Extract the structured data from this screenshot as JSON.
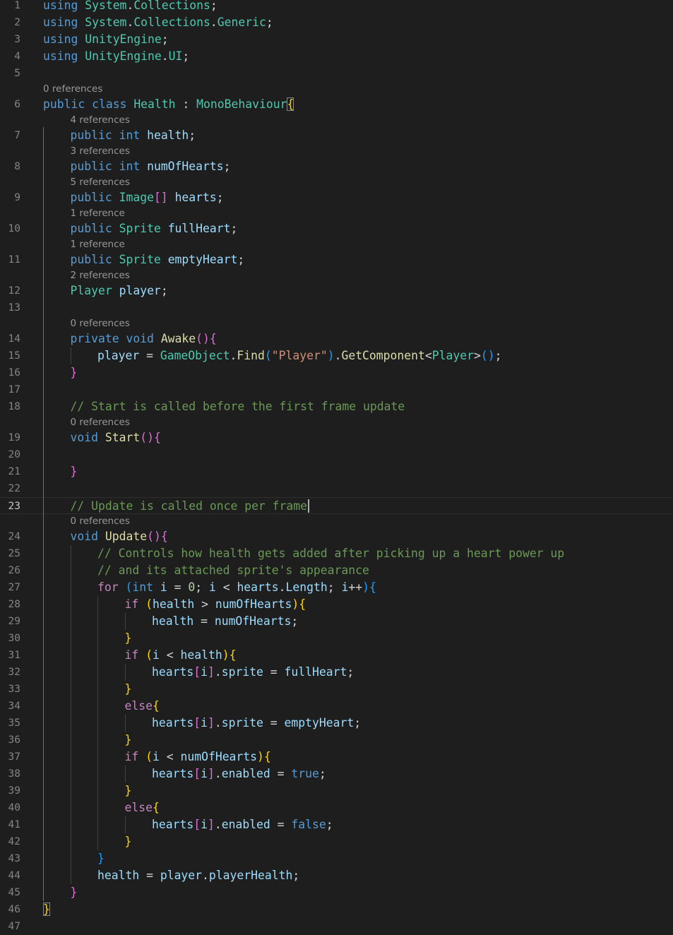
{
  "editor": {
    "active_line": 23,
    "cursor_line": 23,
    "tab_width": 4
  },
  "colors": {
    "background": "#1e1e1e",
    "line_number": "#858585",
    "line_number_active": "#c6c6c6",
    "keyword": "#569cd6",
    "control_keyword": "#c586c0",
    "type": "#4ec9b0",
    "function": "#dcdcaa",
    "variable": "#9cdcfe",
    "string": "#ce9178",
    "number": "#b5cea8",
    "comment": "#6a9955",
    "bracket_level_1": "#ffd700",
    "bracket_level_2": "#da70d6",
    "bracket_level_3": "#179fff",
    "codelens": "#999999"
  },
  "lines": [
    {
      "n": "1",
      "tokens": [
        [
          "k",
          "using"
        ],
        [
          "p",
          " "
        ],
        [
          "t",
          "System"
        ],
        [
          "p",
          "."
        ],
        [
          "t",
          "Collections"
        ],
        [
          "p",
          ";"
        ]
      ]
    },
    {
      "n": "2",
      "tokens": [
        [
          "k",
          "using"
        ],
        [
          "p",
          " "
        ],
        [
          "t",
          "System"
        ],
        [
          "p",
          "."
        ],
        [
          "t",
          "Collections"
        ],
        [
          "p",
          "."
        ],
        [
          "t",
          "Generic"
        ],
        [
          "p",
          ";"
        ]
      ]
    },
    {
      "n": "3",
      "tokens": [
        [
          "k",
          "using"
        ],
        [
          "p",
          " "
        ],
        [
          "t",
          "UnityEngine"
        ],
        [
          "p",
          ";"
        ]
      ]
    },
    {
      "n": "4",
      "tokens": [
        [
          "k",
          "using"
        ],
        [
          "p",
          " "
        ],
        [
          "t",
          "UnityEngine"
        ],
        [
          "p",
          "."
        ],
        [
          "t",
          "UI"
        ],
        [
          "p",
          ";"
        ]
      ]
    },
    {
      "n": "5",
      "tokens": []
    },
    {
      "n": "6",
      "lens": "0 references",
      "tokens": [
        [
          "k",
          "public"
        ],
        [
          "p",
          " "
        ],
        [
          "k",
          "class"
        ],
        [
          "p",
          " "
        ],
        [
          "t",
          "Health"
        ],
        [
          "p",
          " : "
        ],
        [
          "t",
          "MonoBehaviour"
        ],
        [
          "b1m",
          "{"
        ]
      ]
    },
    {
      "n": "7",
      "lens": "4 references",
      "indent": 1,
      "tokens": [
        [
          "k",
          "public"
        ],
        [
          "p",
          " "
        ],
        [
          "k",
          "int"
        ],
        [
          "p",
          " "
        ],
        [
          "v",
          "health"
        ],
        [
          "p",
          ";"
        ]
      ]
    },
    {
      "n": "8",
      "lens": "3 references",
      "indent": 1,
      "tokens": [
        [
          "k",
          "public"
        ],
        [
          "p",
          " "
        ],
        [
          "k",
          "int"
        ],
        [
          "p",
          " "
        ],
        [
          "v",
          "numOfHearts"
        ],
        [
          "p",
          ";"
        ]
      ]
    },
    {
      "n": "9",
      "lens": "5 references",
      "indent": 1,
      "tokens": [
        [
          "k",
          "public"
        ],
        [
          "p",
          " "
        ],
        [
          "t",
          "Image"
        ],
        [
          "b2",
          "[]"
        ],
        [
          "p",
          " "
        ],
        [
          "v",
          "hearts"
        ],
        [
          "p",
          ";"
        ]
      ]
    },
    {
      "n": "10",
      "lens": "1 reference",
      "indent": 1,
      "tokens": [
        [
          "k",
          "public"
        ],
        [
          "p",
          " "
        ],
        [
          "t",
          "Sprite"
        ],
        [
          "p",
          " "
        ],
        [
          "v",
          "fullHeart"
        ],
        [
          "p",
          ";"
        ]
      ]
    },
    {
      "n": "11",
      "lens": "1 reference",
      "indent": 1,
      "tokens": [
        [
          "k",
          "public"
        ],
        [
          "p",
          " "
        ],
        [
          "t",
          "Sprite"
        ],
        [
          "p",
          " "
        ],
        [
          "v",
          "emptyHeart"
        ],
        [
          "p",
          ";"
        ]
      ]
    },
    {
      "n": "12",
      "lens": "2 references",
      "indent": 1,
      "tokens": [
        [
          "t",
          "Player"
        ],
        [
          "p",
          " "
        ],
        [
          "v",
          "player"
        ],
        [
          "p",
          ";"
        ]
      ]
    },
    {
      "n": "13",
      "tokens": []
    },
    {
      "n": "14",
      "lens": "0 references",
      "indent": 1,
      "tokens": [
        [
          "k",
          "private"
        ],
        [
          "p",
          " "
        ],
        [
          "k",
          "void"
        ],
        [
          "p",
          " "
        ],
        [
          "f",
          "Awake"
        ],
        [
          "b2",
          "(){"
        ]
      ]
    },
    {
      "n": "15",
      "indent": 2,
      "tokens": [
        [
          "v",
          "player"
        ],
        [
          "p",
          " = "
        ],
        [
          "t",
          "GameObject"
        ],
        [
          "p",
          "."
        ],
        [
          "f",
          "Find"
        ],
        [
          "b3",
          "("
        ],
        [
          "s",
          "\"Player\""
        ],
        [
          "b3",
          ")"
        ],
        [
          "p",
          "."
        ],
        [
          "f",
          "GetComponent"
        ],
        [
          "p",
          "<"
        ],
        [
          "t",
          "Player"
        ],
        [
          "p",
          ">"
        ],
        [
          "b3",
          "()"
        ],
        [
          "p",
          ";"
        ]
      ]
    },
    {
      "n": "16",
      "indent": 1,
      "tokens": [
        [
          "b2",
          "}"
        ]
      ]
    },
    {
      "n": "17",
      "tokens": []
    },
    {
      "n": "18",
      "indent": 1,
      "tokens": [
        [
          "cm",
          "// Start is called before the first frame update"
        ]
      ]
    },
    {
      "n": "19",
      "lens": "0 references",
      "indent": 1,
      "tokens": [
        [
          "k",
          "void"
        ],
        [
          "p",
          " "
        ],
        [
          "f",
          "Start"
        ],
        [
          "b2",
          "(){"
        ]
      ]
    },
    {
      "n": "20",
      "tokens": []
    },
    {
      "n": "21",
      "indent": 1,
      "tokens": [
        [
          "b2",
          "}"
        ]
      ]
    },
    {
      "n": "22",
      "tokens": []
    },
    {
      "n": "23",
      "indent": 1,
      "tokens": [
        [
          "cm",
          "// Update is called once per frame"
        ]
      ]
    },
    {
      "n": "24",
      "lens": "0 references",
      "indent": 1,
      "tokens": [
        [
          "k",
          "void"
        ],
        [
          "p",
          " "
        ],
        [
          "f",
          "Update"
        ],
        [
          "b2",
          "(){"
        ]
      ]
    },
    {
      "n": "25",
      "indent": 2,
      "tokens": [
        [
          "cm",
          "// Controls how health gets added after picking up a heart power up"
        ]
      ]
    },
    {
      "n": "26",
      "indent": 2,
      "tokens": [
        [
          "cm",
          "// and its attached sprite's appearance"
        ]
      ]
    },
    {
      "n": "27",
      "indent": 2,
      "tokens": [
        [
          "c",
          "for"
        ],
        [
          "p",
          " "
        ],
        [
          "b3",
          "("
        ],
        [
          "k",
          "int"
        ],
        [
          "p",
          " "
        ],
        [
          "v",
          "i"
        ],
        [
          "p",
          " = "
        ],
        [
          "n",
          "0"
        ],
        [
          "p",
          "; "
        ],
        [
          "v",
          "i"
        ],
        [
          "p",
          " < "
        ],
        [
          "v",
          "hearts"
        ],
        [
          "p",
          "."
        ],
        [
          "v",
          "Length"
        ],
        [
          "p",
          "; "
        ],
        [
          "v",
          "i"
        ],
        [
          "p",
          "++"
        ],
        [
          "b3",
          "){"
        ]
      ]
    },
    {
      "n": "28",
      "indent": 3,
      "tokens": [
        [
          "c",
          "if"
        ],
        [
          "p",
          " "
        ],
        [
          "b1",
          "("
        ],
        [
          "v",
          "health"
        ],
        [
          "p",
          " > "
        ],
        [
          "v",
          "numOfHearts"
        ],
        [
          "b1",
          "){"
        ]
      ]
    },
    {
      "n": "29",
      "indent": 4,
      "tokens": [
        [
          "v",
          "health"
        ],
        [
          "p",
          " = "
        ],
        [
          "v",
          "numOfHearts"
        ],
        [
          "p",
          ";"
        ]
      ]
    },
    {
      "n": "30",
      "indent": 3,
      "tokens": [
        [
          "b1",
          "}"
        ]
      ]
    },
    {
      "n": "31",
      "indent": 3,
      "tokens": [
        [
          "c",
          "if"
        ],
        [
          "p",
          " "
        ],
        [
          "b1",
          "("
        ],
        [
          "v",
          "i"
        ],
        [
          "p",
          " < "
        ],
        [
          "v",
          "health"
        ],
        [
          "b1",
          "){"
        ]
      ]
    },
    {
      "n": "32",
      "indent": 4,
      "tokens": [
        [
          "v",
          "hearts"
        ],
        [
          "b2",
          "["
        ],
        [
          "v",
          "i"
        ],
        [
          "b2",
          "]"
        ],
        [
          "p",
          "."
        ],
        [
          "v",
          "sprite"
        ],
        [
          "p",
          " = "
        ],
        [
          "v",
          "fullHeart"
        ],
        [
          "p",
          ";"
        ]
      ]
    },
    {
      "n": "33",
      "indent": 3,
      "tokens": [
        [
          "b1",
          "}"
        ]
      ]
    },
    {
      "n": "34",
      "indent": 3,
      "tokens": [
        [
          "c",
          "else"
        ],
        [
          "b1",
          "{"
        ]
      ]
    },
    {
      "n": "35",
      "indent": 4,
      "tokens": [
        [
          "v",
          "hearts"
        ],
        [
          "b2",
          "["
        ],
        [
          "v",
          "i"
        ],
        [
          "b2",
          "]"
        ],
        [
          "p",
          "."
        ],
        [
          "v",
          "sprite"
        ],
        [
          "p",
          " = "
        ],
        [
          "v",
          "emptyHeart"
        ],
        [
          "p",
          ";"
        ]
      ]
    },
    {
      "n": "36",
      "indent": 3,
      "tokens": [
        [
          "b1",
          "}"
        ]
      ]
    },
    {
      "n": "37",
      "indent": 3,
      "tokens": [
        [
          "c",
          "if"
        ],
        [
          "p",
          " "
        ],
        [
          "b1",
          "("
        ],
        [
          "v",
          "i"
        ],
        [
          "p",
          " < "
        ],
        [
          "v",
          "numOfHearts"
        ],
        [
          "b1",
          "){"
        ]
      ]
    },
    {
      "n": "38",
      "indent": 4,
      "tokens": [
        [
          "v",
          "hearts"
        ],
        [
          "b2",
          "["
        ],
        [
          "v",
          "i"
        ],
        [
          "b2",
          "]"
        ],
        [
          "p",
          "."
        ],
        [
          "v",
          "enabled"
        ],
        [
          "p",
          " = "
        ],
        [
          "k",
          "true"
        ],
        [
          "p",
          ";"
        ]
      ]
    },
    {
      "n": "39",
      "indent": 3,
      "tokens": [
        [
          "b1",
          "}"
        ]
      ]
    },
    {
      "n": "40",
      "indent": 3,
      "tokens": [
        [
          "c",
          "else"
        ],
        [
          "b1",
          "{"
        ]
      ]
    },
    {
      "n": "41",
      "indent": 4,
      "tokens": [
        [
          "v",
          "hearts"
        ],
        [
          "b2",
          "["
        ],
        [
          "v",
          "i"
        ],
        [
          "b2",
          "]"
        ],
        [
          "p",
          "."
        ],
        [
          "v",
          "enabled"
        ],
        [
          "p",
          " = "
        ],
        [
          "k",
          "false"
        ],
        [
          "p",
          ";"
        ]
      ]
    },
    {
      "n": "42",
      "indent": 3,
      "tokens": [
        [
          "b1",
          "}"
        ]
      ]
    },
    {
      "n": "43",
      "indent": 2,
      "tokens": [
        [
          "b3",
          "}"
        ]
      ]
    },
    {
      "n": "44",
      "indent": 2,
      "tokens": [
        [
          "v",
          "health"
        ],
        [
          "p",
          " = "
        ],
        [
          "v",
          "player"
        ],
        [
          "p",
          "."
        ],
        [
          "v",
          "playerHealth"
        ],
        [
          "p",
          ";"
        ]
      ]
    },
    {
      "n": "45",
      "indent": 1,
      "tokens": [
        [
          "b2",
          "}"
        ]
      ]
    },
    {
      "n": "46",
      "tokens": [
        [
          "b1m",
          "}"
        ]
      ]
    },
    {
      "n": "47",
      "tokens": []
    }
  ]
}
